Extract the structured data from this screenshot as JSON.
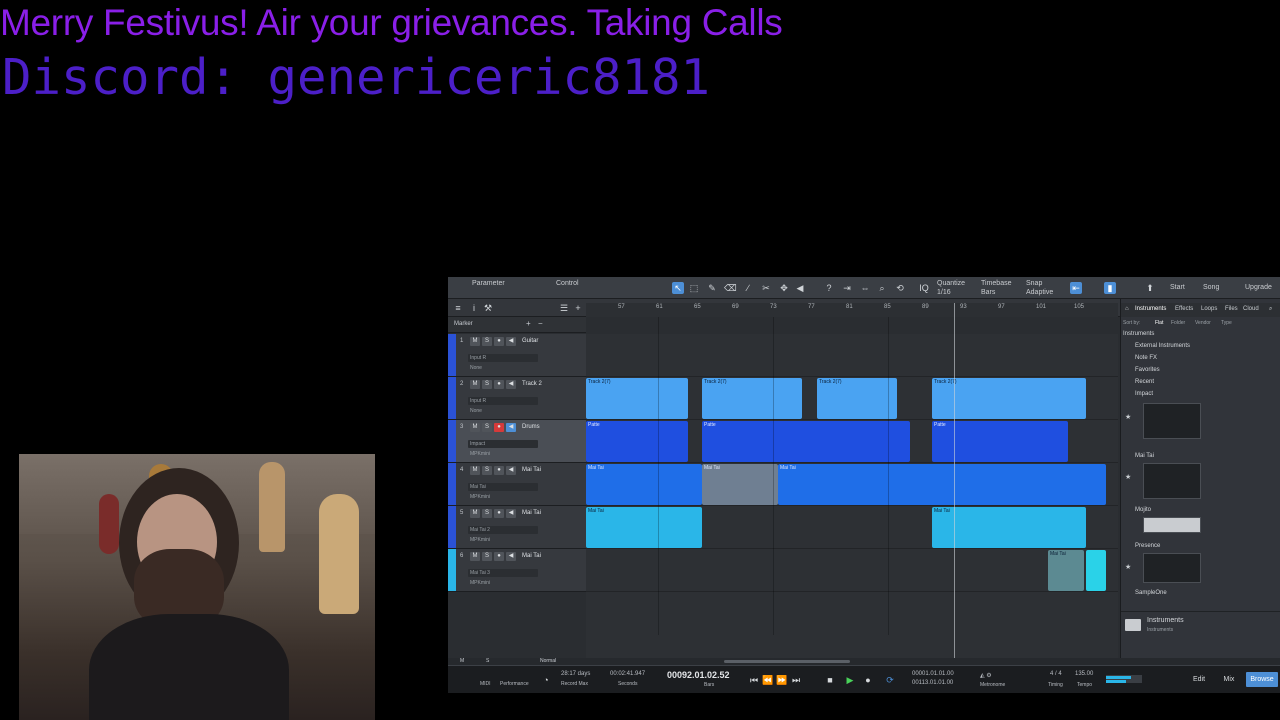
{
  "overlay": {
    "line1": "Merry Festivus! Air your grievances. Taking Calls",
    "line2": "Discord: genericeric8181"
  },
  "colors": {
    "line1": "#8a1fe8",
    "line2": "#4c1fc8",
    "accent": "#4d8fd6",
    "clip_light_blue": "#4aa3f2",
    "clip_dark_blue": "#1f4fe0",
    "clip_cyan": "#2ab6e8"
  },
  "daw": {
    "toolbar": {
      "parameter": "Parameter",
      "control": "Control",
      "quantize_label": "Quantize",
      "quantize_value": "1/16",
      "timebase_label": "Timebase",
      "timebase_value": "Bars",
      "snap_label": "Snap",
      "snap_value": "Adaptive",
      "start": "Start",
      "song": "Song",
      "upgrade": "Upgrade"
    },
    "marker_label": "Marker",
    "ruler": [
      "57",
      "61",
      "65",
      "69",
      "73",
      "77",
      "81",
      "85",
      "89",
      "93",
      "97",
      "101",
      "105"
    ],
    "tracks": [
      {
        "num": "1",
        "name": "Guitar",
        "sub1": "Input R",
        "sub2": "None",
        "color": "#2b52d6"
      },
      {
        "num": "2",
        "name": "Track 2",
        "sub1": "Input R",
        "sub2": "None",
        "color": "#2b52d6"
      },
      {
        "num": "3",
        "name": "Drums",
        "sub1": "Impact",
        "sub2": "MPKmini",
        "color": "#2b52d6"
      },
      {
        "num": "4",
        "name": "Mai Tai",
        "sub1": "Mai Tai",
        "sub2": "MPKmini",
        "color": "#2b52d6"
      },
      {
        "num": "5",
        "name": "Mai Tai",
        "sub1": "Mai Tai 2",
        "sub2": "MPKmini",
        "color": "#2b52d6"
      },
      {
        "num": "6",
        "name": "Mai Tai",
        "sub1": "Mai Tai 3",
        "sub2": "MPKmini",
        "color": "#2ab6e8"
      }
    ],
    "clip_labels": {
      "audio": "Track 2(7)",
      "pattern": "Patte",
      "maitai": "Mai Tai"
    },
    "browser": {
      "tabs": [
        "Instruments",
        "Effects",
        "Loops",
        "Files",
        "Cloud"
      ],
      "sort_by": "Sort by:",
      "sort_options": [
        "Flat",
        "Folder",
        "Vendor",
        "Type"
      ],
      "root": "Instruments",
      "items": [
        "External Instruments",
        "Note FX",
        "Favorites",
        "Recent",
        "Impact",
        "Mai Tai",
        "Mojito",
        "Presence",
        "SampleOne"
      ],
      "footer_title": "Instruments",
      "footer_sub": "Instruments"
    },
    "bottom": {
      "mode": "Normal"
    },
    "transport": {
      "midi": "MIDI",
      "performance": "Performance",
      "record_days": "28:17 days",
      "record_max": "Record Max",
      "seconds_value": "00:02:41.947",
      "seconds_label": "Seconds",
      "position": "00092.01.02.52",
      "position_label": "Bars",
      "loop_l": "00001.01.01.00",
      "loop_r": "00113.01.01.00",
      "metronome": "Metronome",
      "signature": "4 / 4",
      "timing": "Timing",
      "tempo_value": "135.00",
      "tempo_label": "Tempo",
      "edit": "Edit",
      "mix": "Mix",
      "browse": "Browse"
    }
  }
}
